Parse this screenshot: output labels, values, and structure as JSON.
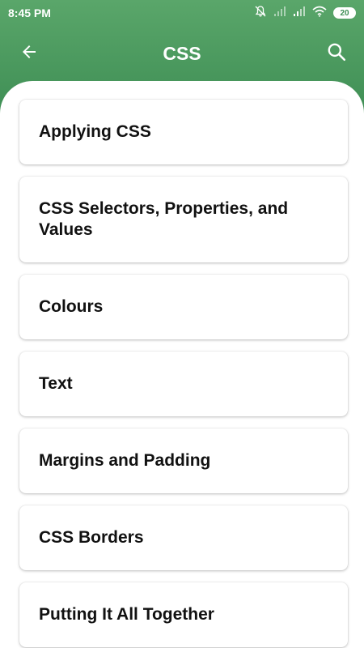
{
  "status_bar": {
    "time": "8:45 PM",
    "battery": "20",
    "icons": [
      "notifications-off-icon",
      "signal-icon",
      "signal-icon",
      "wifi-icon",
      "battery-icon"
    ]
  },
  "app_bar": {
    "title": "CSS",
    "back_icon": "arrow-back-icon",
    "search_icon": "search-icon"
  },
  "colors": {
    "header_green": "#4a9a5e",
    "card_bg": "#ffffff",
    "text": "#111111"
  },
  "topics": [
    {
      "label": "Applying CSS"
    },
    {
      "label": "CSS Selectors, Properties, and Values"
    },
    {
      "label": "Colours"
    },
    {
      "label": "Text"
    },
    {
      "label": "Margins and Padding"
    },
    {
      "label": "CSS Borders"
    },
    {
      "label": "Putting It All Together"
    }
  ]
}
